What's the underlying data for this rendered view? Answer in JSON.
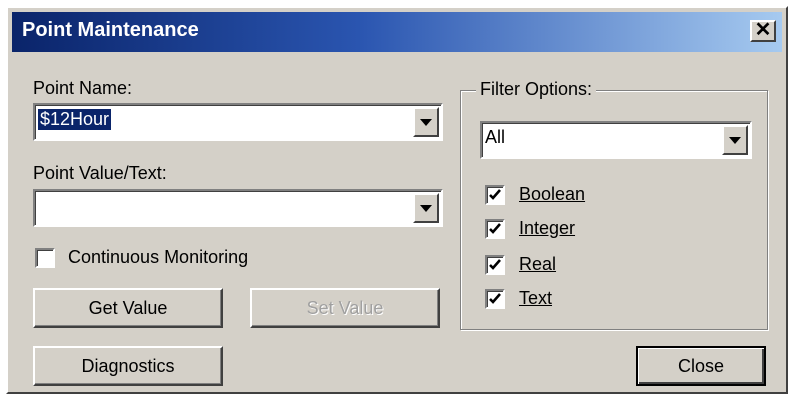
{
  "window": {
    "title": "Point Maintenance",
    "close_glyph": "✕"
  },
  "point_name": {
    "label": "Point Name:",
    "value": "$12Hour"
  },
  "point_value": {
    "label": "Point Value/Text:",
    "value": ""
  },
  "continuous_monitoring": {
    "label": "Continuous Monitoring",
    "checked": false
  },
  "buttons": {
    "get_value": "Get Value",
    "set_value": "Set Value",
    "diagnostics": "Diagnostics",
    "close": "Close"
  },
  "filter": {
    "title": "Filter Options:",
    "selected": "All",
    "types": [
      {
        "label": "Boolean",
        "checked": true
      },
      {
        "label": "Integer",
        "checked": true
      },
      {
        "label": "Real",
        "checked": true
      },
      {
        "label": "Text",
        "checked": true
      }
    ]
  }
}
